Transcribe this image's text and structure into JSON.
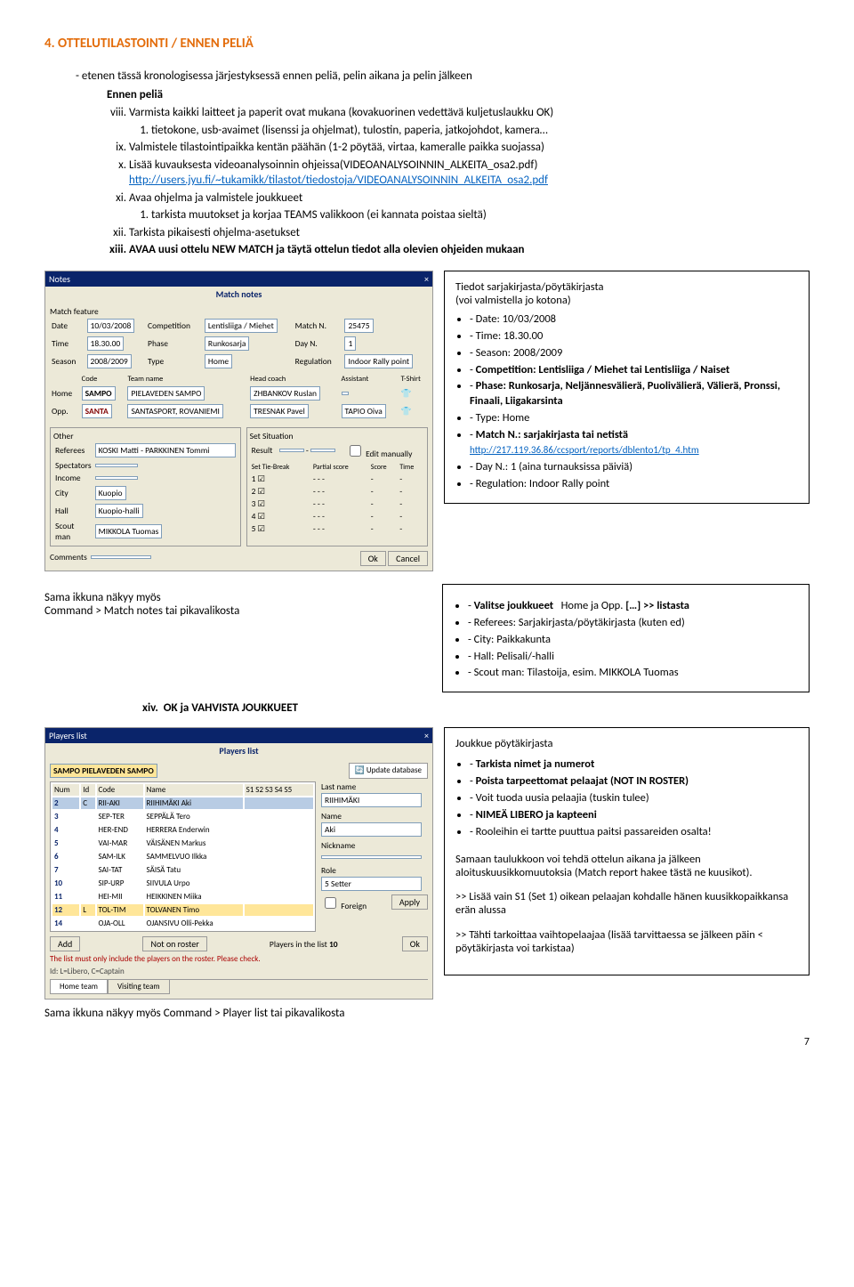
{
  "heading": "4.  OTTELUTILASTOINTI / ENNEN PELIÄ",
  "intro": "-   etenen tässä kronologisessa järjestyksessä ennen peliä, pelin aikana ja pelin jälkeen",
  "ep": "Ennen peliä",
  "roman": {
    "viii": "Varmista kaikki laitteet ja paperit ovat mukana (kovakuorinen vedettävä kuljetuslaukku OK)",
    "viii_1": "tietokone, usb-avaimet (lisenssi ja ohjelmat), tulostin, paperia, jatkojohdot, kamera…",
    "ix": "Valmistele tilastointipaikka kentän päähän (1-2 pöytää, virtaa, kameralle paikka suojassa)",
    "x_pre": "Lisää kuvauksesta videoanalysoinnin ohjeissa(VIDEOANALYSOINNIN_ALKEITA_osa2.pdf)",
    "x_link": "http://users.jyu.fi/~tukamikk/tilastot/tiedostoja/VIDEOANALYSOINNIN_ALKEITA_osa2.pdf",
    "xi": "Avaa ohjelma ja valmistele joukkueet",
    "xi_1": "tarkista muutokset ja korjaa TEAMS valikkoon (ei kannata poistaa sieltä)",
    "xii": "Tarkista pikaisesti ohjelma-asetukset",
    "xiii": "AVAA uusi ottelu NEW MATCH ja täytä ottelun tiedot alla olevien ohjeiden mukaan",
    "xiv": "OK ja VAHVISTA JOUKKUEET"
  },
  "notesWin": {
    "bar": "Notes",
    "title": "Match notes",
    "feature": "Match feature",
    "date_lbl": "Date",
    "date": "10/03/2008",
    "comp_lbl": "Competition",
    "comp": "Lentisliiga / Miehet",
    "matchn_lbl": "Match N.",
    "matchn": "25475",
    "time_lbl": "Time",
    "time": "18.30.00",
    "phase_lbl": "Phase",
    "phase": "Runkosarja",
    "dayn_lbl": "Day N.",
    "dayn": "1",
    "season_lbl": "Season",
    "season": "2008/2009",
    "type_lbl": "Type",
    "type": "Home",
    "reg_lbl": "Regulation",
    "reg": "Indoor Rally point",
    "h_code": "SAMPO",
    "h_team": "PIELAVEDEN SAMPO",
    "h_coach": "ZHBANKOV Ruslan",
    "o_code": "SANTA",
    "o_team": "SANTASPORT, ROVANIEMI",
    "o_coach": "TRESNAK Pavel",
    "o_ass": "TAPIO Oiva",
    "code_h": "Code",
    "team_h": "Team name",
    "coach_h": "Head coach",
    "ass_h": "Assistant",
    "shirt_h": "T-Shirt",
    "home_lbl": "Home",
    "opp_lbl": "Opp.",
    "other": "Other",
    "set": "Set Situation",
    "ref_lbl": "Referees",
    "ref": "KOSKI Matti - PARKKINEN Tommi",
    "spec_lbl": "Spectators",
    "inc_lbl": "Income",
    "city_lbl": "City",
    "city": "Kuopio",
    "hall_lbl": "Hall",
    "hall": "Kuopio-halli",
    "scout_lbl": "Scout man",
    "scout": "MIKKOLA Tuomas",
    "result_lbl": "Result",
    "edit": "Edit manually",
    "stb": "Set Tie-Break",
    "ps": "Partial score",
    "sc": "Score",
    "tm": "Time",
    "comments": "Comments",
    "ok": "Ok",
    "cancel": "Cancel"
  },
  "box1": {
    "title": "Tiedot sarjakirjasta/pöytäkirjasta",
    "sub": "(voi valmistella jo kotona)",
    "li1": "Date: 10/03/2008",
    "li2": "Time: 18.30.00",
    "li3": "Season: 2008/2009",
    "li4": "Competition: Lentisliiga / Miehet tai Lentisliiga / Naiset",
    "li5": "Phase: Runkosarja, Neljännesvälierä, Puolivälierä, Välierä, Pronssi, Finaali, Liigakarsinta",
    "li6": "Type: Home",
    "li7_pre": "Match N.: sarjakirjasta tai netistä",
    "li7_link": "http://217.119.36.86/ccsport/reports/dblento1/tp_4.htm",
    "li8": "Day N.: 1 (aina turnauksissa päiviä)",
    "li9": "Regulation: Indoor Rally point"
  },
  "cap1": "Sama ikkuna näkyy myös",
  "cap1b": "Command > Match notes tai pikavalikosta",
  "box2": {
    "li1_pre": "Valitse joukkueet",
    "li1_mid": "Home ja Opp.",
    "li1_post": "[…] >> listasta",
    "li2": "Referees: Sarjakirjasta/pöytäkirjasta (kuten ed)",
    "li3": "City: Paikkakunta",
    "li4": "Hall: Pelisali/-halli",
    "li5": "Scout man: Tilastoija, esim. MIKKOLA Tuomas"
  },
  "playersWin": {
    "bar": "Players list",
    "title": "Players list",
    "team": "SAMPO PIELAVEDEN SAMPO",
    "update": "Update database",
    "h_num": "Num",
    "h_id": "Id",
    "h_code": "Code",
    "h_name": "Name",
    "h_s": "S1 S2 S3 S4 S5",
    "rows": [
      {
        "n": "2",
        "id": "C",
        "code": "RII-AKI",
        "name": "RIIHIMÄKI Aki"
      },
      {
        "n": "3",
        "id": "",
        "code": "SEP-TER",
        "name": "SEPPÄLÄ Tero"
      },
      {
        "n": "4",
        "id": "",
        "code": "HER-END",
        "name": "HERRERA Enderwin"
      },
      {
        "n": "5",
        "id": "",
        "code": "VAI-MAR",
        "name": "VÄISÄNEN Markus"
      },
      {
        "n": "6",
        "id": "",
        "code": "SAM-ILK",
        "name": "SAMMELVUO Ilkka"
      },
      {
        "n": "7",
        "id": "",
        "code": "SAI-TAT",
        "name": "SÄISÄ Tatu"
      },
      {
        "n": "10",
        "id": "",
        "code": "SIP-URP",
        "name": "SIIVULA Urpo"
      },
      {
        "n": "11",
        "id": "",
        "code": "HEI-MII",
        "name": "HEIKKINEN Miika"
      },
      {
        "n": "12",
        "id": "L",
        "code": "TOL-TIM",
        "name": "TOLVANEN Timo"
      },
      {
        "n": "14",
        "id": "",
        "code": "OJA-OLL",
        "name": "OJANSIVU Olli-Pekka"
      }
    ],
    "ln_lbl": "Last name",
    "ln": "RIIHIMÄKI",
    "nm_lbl": "Name",
    "nm": "Aki",
    "nick_lbl": "Nickname",
    "role_lbl": "Role",
    "role": "5 Setter",
    "foreign": "Foreign",
    "apply": "Apply",
    "add": "Add",
    "not": "Not on roster",
    "pil": "Players in the list",
    "pil_n": "10",
    "ok": "Ok",
    "hint": "The list must only include the players on the roster. Please check.",
    "hint2": "Id: L=Libero, C=Captain",
    "tab1": "Home team",
    "tab2": "Visiting team"
  },
  "box3": {
    "title": "Joukkue pöytäkirjasta",
    "li1": "Tarkista nimet ja numerot",
    "li2": "Poista tarpeettomat pelaajat (NOT IN ROSTER)",
    "li3": "Voit tuoda uusia pelaajia (tuskin tulee)",
    "li4": "NIMEÄ LIBERO ja kapteeni",
    "li5": "Rooleihin ei tartte puuttua paitsi passareiden osalta!",
    "p1": "Samaan taulukkoon voi tehdä ottelun aikana ja jälkeen aloituskuusikkomuutoksia (Match report hakee tästä ne kuusikot).",
    "p2": ">> Lisää vain S1 (Set 1) oikean pelaajan kohdalle hänen kuusikkopaikkansa erän alussa",
    "p3": ">> Tähti tarkoittaa vaihtopelaajaa (lisää tarvittaessa se jälkeen päin < pöytäkirjasta voi tarkistaa)"
  },
  "cap2": "Sama ikkuna näkyy myös Command > Player list tai pikavalikosta",
  "page": "7"
}
